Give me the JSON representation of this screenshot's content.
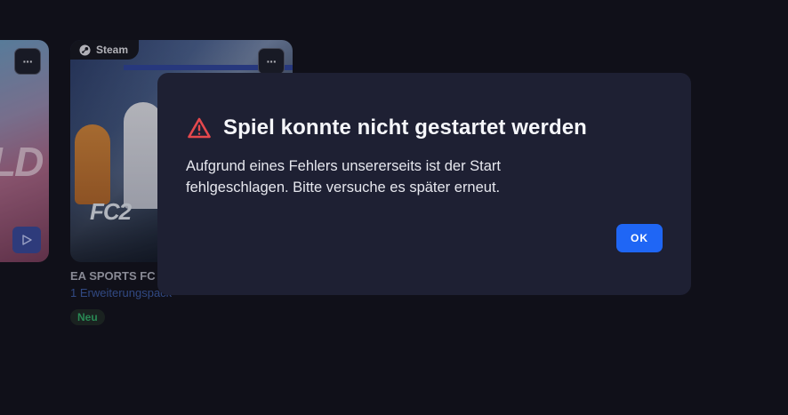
{
  "library": {
    "cards": [
      {
        "art_text": "LD",
        "menu_label": "···"
      },
      {
        "platform": "Steam",
        "art_text": "FC2",
        "menu_label": "···",
        "title": "EA SPORTS FC",
        "subtitle": "1 Erweiterungspack",
        "badge": "Neu"
      }
    ]
  },
  "dialog": {
    "title": "Spiel konnte nicht gestartet werden",
    "message": "Aufgrund eines Fehlers unsererseits ist der Start fehlgeschlagen. Bitte versuche es später erneut.",
    "ok_label": "OK",
    "icon": "warning-triangle-icon"
  },
  "colors": {
    "background": "#12121b",
    "dialog_background": "#1e2033",
    "accent_blue": "#1f66f5",
    "warning_red": "#e5484d",
    "new_badge_green": "#33b36a",
    "subtitle_blue": "#3e5ea8"
  }
}
